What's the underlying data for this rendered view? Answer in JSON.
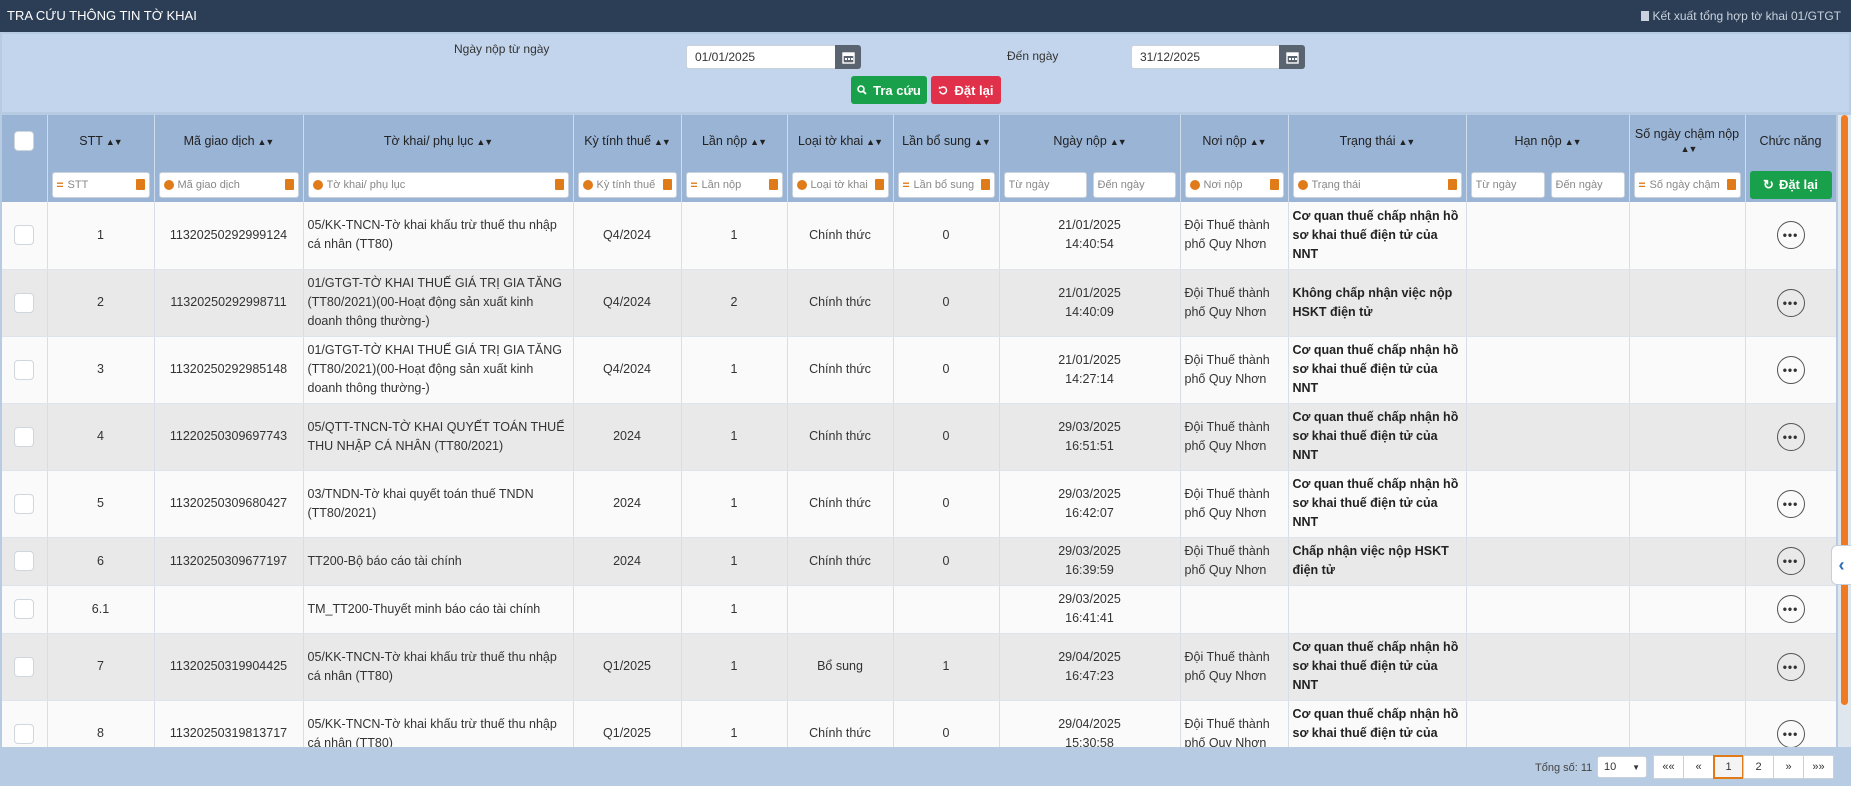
{
  "header": {
    "title": "TRA CỨU THÔNG TIN TỜ KHAI",
    "export_label": "Kết xuất tổng hợp tờ khai 01/GTGT"
  },
  "filters": {
    "from_label": "Ngày nộp từ ngày",
    "from_value": "01/01/2025",
    "to_label": "Đến ngày",
    "to_value": "31/12/2025",
    "search_label": "Tra cứu",
    "reset_label": "Đặt lại"
  },
  "table": {
    "columns": {
      "stt": "STT",
      "ma_gd": "Mã giao dịch",
      "to_khai": "Tờ khai/ phụ lục",
      "ky_tinh_thue": "Kỳ tính thuế",
      "lan_nop": "Lần nộp",
      "loai_to_khai": "Loại tờ khai",
      "lan_bo_sung": "Lần bổ sung",
      "ngay_nop": "Ngày nộp",
      "noi_nop": "Nơi nộp",
      "trang_thai": "Trạng thái",
      "han_nop": "Hạn nộp",
      "so_ngay_cham_nop": "Số ngày chậm nộp",
      "chuc_nang": "Chức năng"
    },
    "filter_placeholders": {
      "stt": "STT",
      "ma_gd": "Mã giao dịch",
      "to_khai": "Tờ khai/ phụ lục",
      "ky_tinh_thue": "Kỳ tính thuế",
      "lan_nop": "Lần nộp",
      "loai_to_khai": "Loại tờ khai",
      "lan_bo_sung": "Lần bổ sung",
      "ngay_nop_from": "Từ ngày",
      "ngay_nop_to": "Đến ngày",
      "noi_nop": "Nơi nộp",
      "trang_thai": "Trạng thái",
      "han_nop_from": "Từ ngày",
      "han_nop_to": "Đến ngày",
      "so_ngay": "Số ngày chậm nộp",
      "reset_label": "Đặt lại"
    },
    "rows": [
      {
        "stt": "1",
        "ma_gd": "11320250292999124",
        "to_khai": "05/KK-TNCN-Tờ khai khấu trừ thuế thu nhập cá nhân (TT80)",
        "ky": "Q4/2024",
        "lan_nop": "1",
        "loai": "Chính thức",
        "lan_bs": "0",
        "ngay": "21/01/2025",
        "gio": "14:40:54",
        "noi_nop": "Đội Thuế thành phố Quy Nhơn",
        "trang_thai": "Cơ quan thuế chấp nhận hồ sơ khai thuế điện tử của NNT",
        "han_nop": "",
        "so_ngay": ""
      },
      {
        "stt": "2",
        "ma_gd": "11320250292998711",
        "to_khai": "01/GTGT-TỜ KHAI THUẾ GIÁ TRỊ GIA TĂNG (TT80/2021)(00-Hoạt động sản xuất kinh doanh thông thường-)",
        "ky": "Q4/2024",
        "lan_nop": "2",
        "loai": "Chính thức",
        "lan_bs": "0",
        "ngay": "21/01/2025",
        "gio": "14:40:09",
        "noi_nop": "Đội Thuế thành phố Quy Nhơn",
        "trang_thai": "Không chấp nhận việc nộp HSKT điện tử",
        "han_nop": "",
        "so_ngay": ""
      },
      {
        "stt": "3",
        "ma_gd": "11320250292985148",
        "to_khai": "01/GTGT-TỜ KHAI THUẾ GIÁ TRỊ GIA TĂNG (TT80/2021)(00-Hoạt động sản xuất kinh doanh thông thường-)",
        "ky": "Q4/2024",
        "lan_nop": "1",
        "loai": "Chính thức",
        "lan_bs": "0",
        "ngay": "21/01/2025",
        "gio": "14:27:14",
        "noi_nop": "Đội Thuế thành phố Quy Nhơn",
        "trang_thai": "Cơ quan thuế chấp nhận hồ sơ khai thuế điện tử của NNT",
        "han_nop": "",
        "so_ngay": ""
      },
      {
        "stt": "4",
        "ma_gd": "11220250309697743",
        "to_khai": "05/QTT-TNCN-TỜ KHAI QUYẾT TOÁN THUẾ THU NHẬP CÁ NHÂN (TT80/2021)",
        "ky": "2024",
        "lan_nop": "1",
        "loai": "Chính thức",
        "lan_bs": "0",
        "ngay": "29/03/2025",
        "gio": "16:51:51",
        "noi_nop": "Đội Thuế thành phố Quy Nhơn",
        "trang_thai": "Cơ quan thuế chấp nhận hồ sơ khai thuế điện tử của NNT",
        "han_nop": "",
        "so_ngay": ""
      },
      {
        "stt": "5",
        "ma_gd": "11320250309680427",
        "to_khai": "03/TNDN-Tờ khai quyết toán thuế TNDN (TT80/2021)",
        "ky": "2024",
        "lan_nop": "1",
        "loai": "Chính thức",
        "lan_bs": "0",
        "ngay": "29/03/2025",
        "gio": "16:42:07",
        "noi_nop": "Đội Thuế thành phố Quy Nhơn",
        "trang_thai": "Cơ quan thuế chấp nhận hồ sơ khai thuế điện tử của NNT",
        "han_nop": "",
        "so_ngay": ""
      },
      {
        "stt": "6",
        "ma_gd": "11320250309677197",
        "to_khai": "TT200-Bộ báo cáo tài chính",
        "ky": "2024",
        "lan_nop": "1",
        "loai": "Chính thức",
        "lan_bs": "0",
        "ngay": "29/03/2025",
        "gio": "16:39:59",
        "noi_nop": "Đội Thuế thành phố Quy Nhơn",
        "trang_thai": "Chấp nhận việc nộp HSKT điện tử",
        "han_nop": "",
        "so_ngay": ""
      },
      {
        "stt": "6.1",
        "ma_gd": "",
        "to_khai": "TM_TT200-Thuyết minh báo cáo tài chính",
        "ky": "",
        "lan_nop": "1",
        "loai": "",
        "lan_bs": "",
        "ngay": "29/03/2025",
        "gio": "16:41:41",
        "noi_nop": "",
        "trang_thai": "",
        "han_nop": "",
        "so_ngay": ""
      },
      {
        "stt": "7",
        "ma_gd": "11320250319904425",
        "to_khai": "05/KK-TNCN-Tờ khai khấu trừ thuế thu nhập cá nhân (TT80)",
        "ky": "Q1/2025",
        "lan_nop": "1",
        "loai": "Bổ sung",
        "lan_bs": "1",
        "ngay": "29/04/2025",
        "gio": "16:47:23",
        "noi_nop": "Đội Thuế thành phố Quy Nhơn",
        "trang_thai": "Cơ quan thuế chấp nhận hồ sơ khai thuế điện tử của NNT",
        "han_nop": "",
        "so_ngay": ""
      },
      {
        "stt": "8",
        "ma_gd": "11320250319813717",
        "to_khai": "05/KK-TNCN-Tờ khai khấu trừ thuế thu nhập cá nhân (TT80)",
        "ky": "Q1/2025",
        "lan_nop": "1",
        "loai": "Chính thức",
        "lan_bs": "0",
        "ngay": "29/04/2025",
        "gio": "15:30:58",
        "noi_nop": "Đội Thuế thành phố Quy Nhơn",
        "trang_thai": "Cơ quan thuế chấp nhận hồ sơ khai thuế điện tử của NNT",
        "han_nop": "",
        "so_ngay": ""
      }
    ]
  },
  "footer": {
    "total_label": "Tổng số: 11",
    "page_size": "10",
    "pages": [
      "««",
      "«",
      "1",
      "2",
      "»",
      "»»"
    ],
    "active_page": "1"
  },
  "colors": {
    "titlebar": "#2c3e55",
    "header_bg": "#9ab4d6",
    "filter_bg": "#c3d5ec",
    "accent_orange": "#e07b1a",
    "green": "#18a04a",
    "red": "#e0304a"
  }
}
